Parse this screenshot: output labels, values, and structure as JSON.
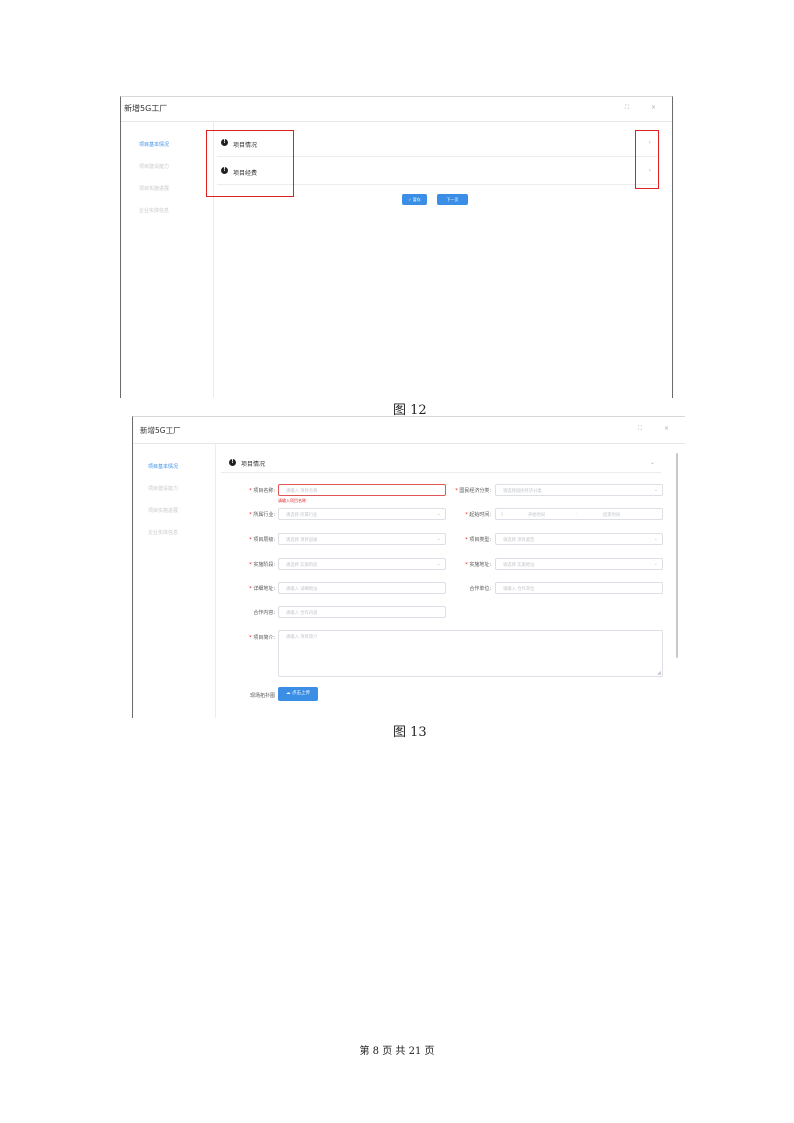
{
  "figure12": {
    "window_title": "新增5G工厂",
    "window_icons": "⛶ ×",
    "sidebar": [
      "项目基本情况",
      "项目建设能力",
      "项目实施进展",
      "企业实体信息"
    ],
    "sections": [
      {
        "label": "项目情况"
      },
      {
        "label": "项目经费"
      }
    ],
    "chevron": "›",
    "info_glyph": "!",
    "buttons": {
      "save": "✓ 暂存",
      "next": "下一页"
    },
    "caption": "图 12",
    "highlight_color": "#e02020"
  },
  "figure13": {
    "window_title": "新增5G工厂",
    "window_icons": "⛶ ×",
    "sidebar": [
      "项目基本情况",
      "项目建设能力",
      "项目实施进展",
      "企业实体信息"
    ],
    "section_label": "项目情况",
    "info_glyph": "!",
    "chevron": "⌄",
    "fields": {
      "project_name": {
        "label": "项目名称:",
        "placeholder": "请输入 项目名称",
        "error": "请输入项目名称"
      },
      "econ_class": {
        "label": "国民经济分类:",
        "placeholder": "请选择国民经济分类"
      },
      "industry": {
        "label": "所属行业:",
        "placeholder": "请选择 所属行业"
      },
      "time_range": {
        "label": "起始时间:",
        "start": "开始时间",
        "sep": "-",
        "end": "结束时间",
        "icon": "▯"
      },
      "level": {
        "label": "项目层级:",
        "placeholder": "请选择 项目层级"
      },
      "type": {
        "label": "项目类型:",
        "placeholder": "请选择 项目类型"
      },
      "stage": {
        "label": "实施阶段:",
        "placeholder": "请选择 实施阶段"
      },
      "location": {
        "label": "实施地址:",
        "placeholder": "请选择 实施地址"
      },
      "address": {
        "label": "详细地址:",
        "placeholder": "请输入 详细地址"
      },
      "partner": {
        "label": "合作单位:",
        "placeholder": "请输入 合作单位"
      },
      "coop": {
        "label": "合作内容:",
        "placeholder": "请输入 合作内容"
      },
      "intro": {
        "label": "项目简介:",
        "placeholder": "请输入 项目简介"
      },
      "topology": {
        "label": "现场拓扑图",
        "button": "☁ 点击上传"
      }
    },
    "caption": "图 13",
    "accent": "#3a8ee6"
  },
  "footer": "第 8 页 共 21 页"
}
